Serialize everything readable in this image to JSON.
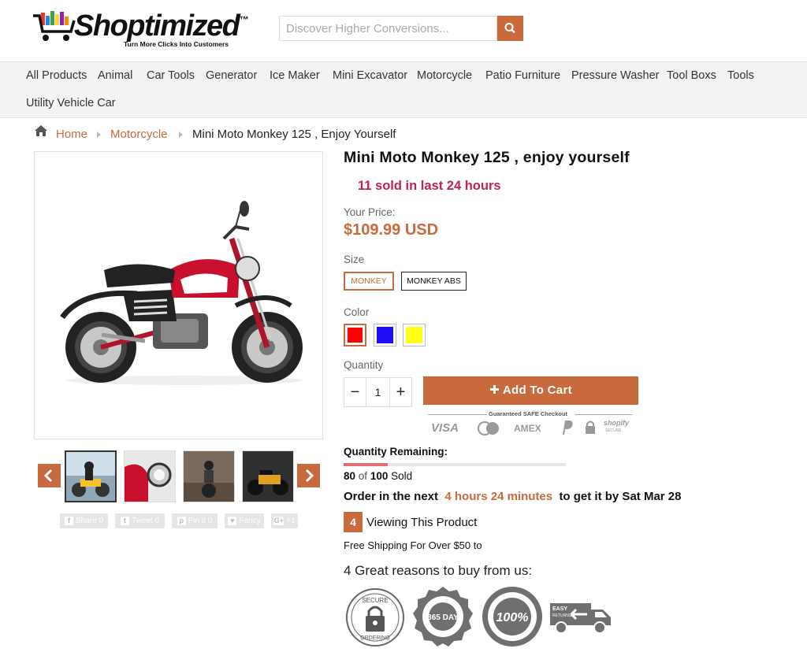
{
  "header": {
    "logo_text": "Shoptimized",
    "logo_tm": "™",
    "logo_tagline": "Turn More Clicks Into Customers",
    "search_placeholder": "Discover Higher Conversions...",
    "accent_color": "#c96a3e"
  },
  "nav": {
    "items": [
      "All Products",
      "Animal",
      "Car Tools",
      "Generator",
      "Ice Maker",
      "Mini Excavator",
      "Motorcycle",
      "Patio Furniture",
      "Pressure Washer",
      "Tool Boxs",
      "Tools",
      "Utility Vehicle Car"
    ]
  },
  "breadcrumb": {
    "home": "Home",
    "category": "Motorcycle",
    "current": "Mini Moto Monkey 125 ,  Enjoy Yourself"
  },
  "gallery": {
    "thumbnails": [
      "rider-yellow-bike",
      "red-bike-headlight",
      "rider-front-view",
      "yellow-bike-dark"
    ],
    "share": [
      {
        "icon": "f",
        "label": "Share 0"
      },
      {
        "icon": "t",
        "label": "Tweet 0"
      },
      {
        "icon": "p",
        "label": "Pin it 0"
      },
      {
        "icon": "♥",
        "label": "Fancy"
      },
      {
        "icon": "G+",
        "label": "+1"
      }
    ]
  },
  "product": {
    "title": "Mini Moto Monkey 125 ,   enjoy yourself",
    "sold_text": "11 sold in last 24 hours",
    "price_label": "Your Price:",
    "price": "$109.99 USD",
    "size_label": "Size",
    "sizes": [
      {
        "label": "MONKEY",
        "selected": true
      },
      {
        "label": "MONKEY ABS",
        "selected": false
      }
    ],
    "color_label": "Color",
    "colors": [
      {
        "name": "red",
        "hex": "#ff0000",
        "selected": true
      },
      {
        "name": "blue",
        "hex": "#1f0df5",
        "selected": false
      },
      {
        "name": "yellow",
        "hex": "#ffff1a",
        "selected": false
      }
    ],
    "quantity_label": "Quantity",
    "quantity_minus": "−",
    "quantity_value": "1",
    "quantity_plus": "+",
    "add_to_cart": "Add To Cart",
    "safe_checkout": "Guaranteed SAFE Checkout",
    "payment_logos": [
      "VISA",
      "mastercard",
      "AMEX",
      "paypal",
      "lock",
      "shopify"
    ],
    "payment_visa": "VISA",
    "payment_amex": "AMEX",
    "payment_shopify": "shopify",
    "payment_shopify_sub": "SECURE"
  },
  "stock": {
    "label": "Quantity Remaining:",
    "sold": "80",
    "of_text": "of",
    "total": "100",
    "sold_text": "Sold",
    "fraction_remaining": 0.2
  },
  "delivery": {
    "prefix": "Order in the next",
    "time": "4 hours 24 minutes",
    "suffix": "to get it by Sat Mar 28"
  },
  "viewing": {
    "count": "4",
    "text": "Viewing This Product"
  },
  "shipping_text": "Free Shipping For Over $50 to",
  "reasons": {
    "title": "4 Great reasons to buy from us:",
    "badges": [
      {
        "top": "SECURE",
        "bottom": "ORDERING"
      },
      {
        "center": "365 DAY",
        "ring": "MONEY BACK GUARANTEE"
      },
      {
        "center": "100%",
        "ring": "SATISFACTION GUARANTEED"
      },
      {
        "text": "EASY",
        "sub": "RETURNS"
      }
    ]
  }
}
